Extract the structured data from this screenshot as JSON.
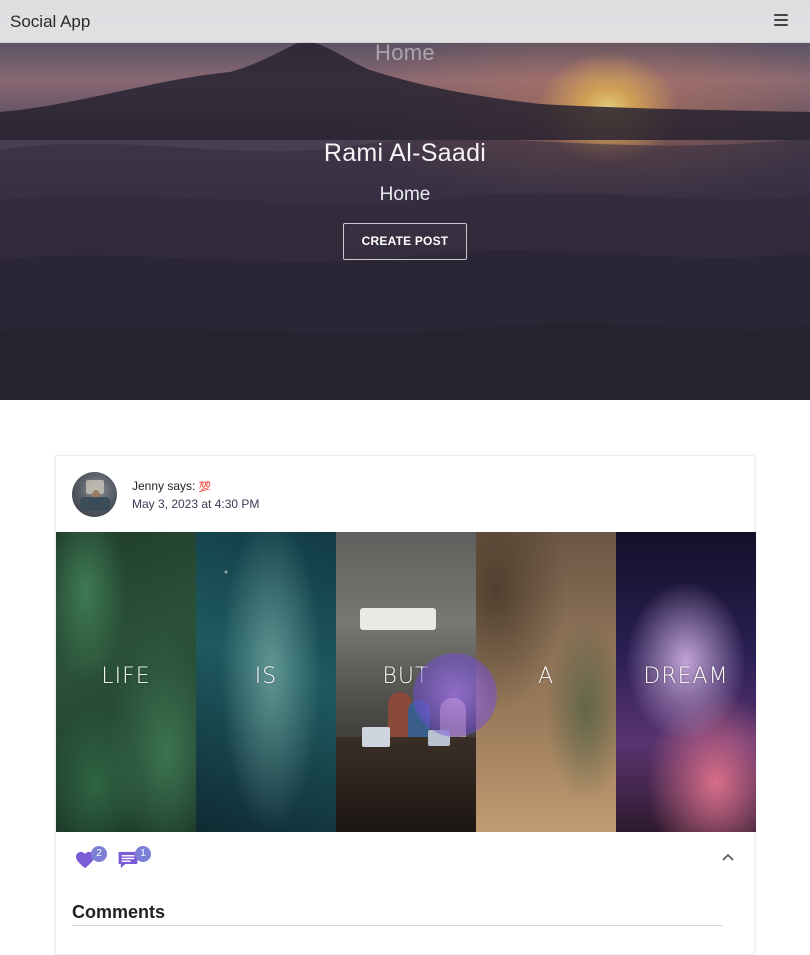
{
  "navbar": {
    "brand": "Social App",
    "menu_icon": "hamburger-menu-icon"
  },
  "hero": {
    "ghost_title": "Home",
    "name": "Rami Al-Saadi",
    "subtitle": "Home",
    "create_button": "CREATE POST"
  },
  "post": {
    "author_line": "Jenny says:",
    "author_emoji": "💯",
    "timestamp": "May 3, 2023 at 4:30 PM",
    "image_words": [
      "LIFE",
      "IS",
      "BUT",
      "A",
      "DREAM"
    ],
    "likes": "2",
    "comments_count": "1",
    "icons": {
      "like": "heart-icon",
      "comment": "comment-icon",
      "collapse": "chevron-up-icon"
    }
  },
  "comments": {
    "title": "Comments"
  },
  "colors": {
    "accent": "#7b5bd6",
    "badge": "#7b7fd6"
  }
}
